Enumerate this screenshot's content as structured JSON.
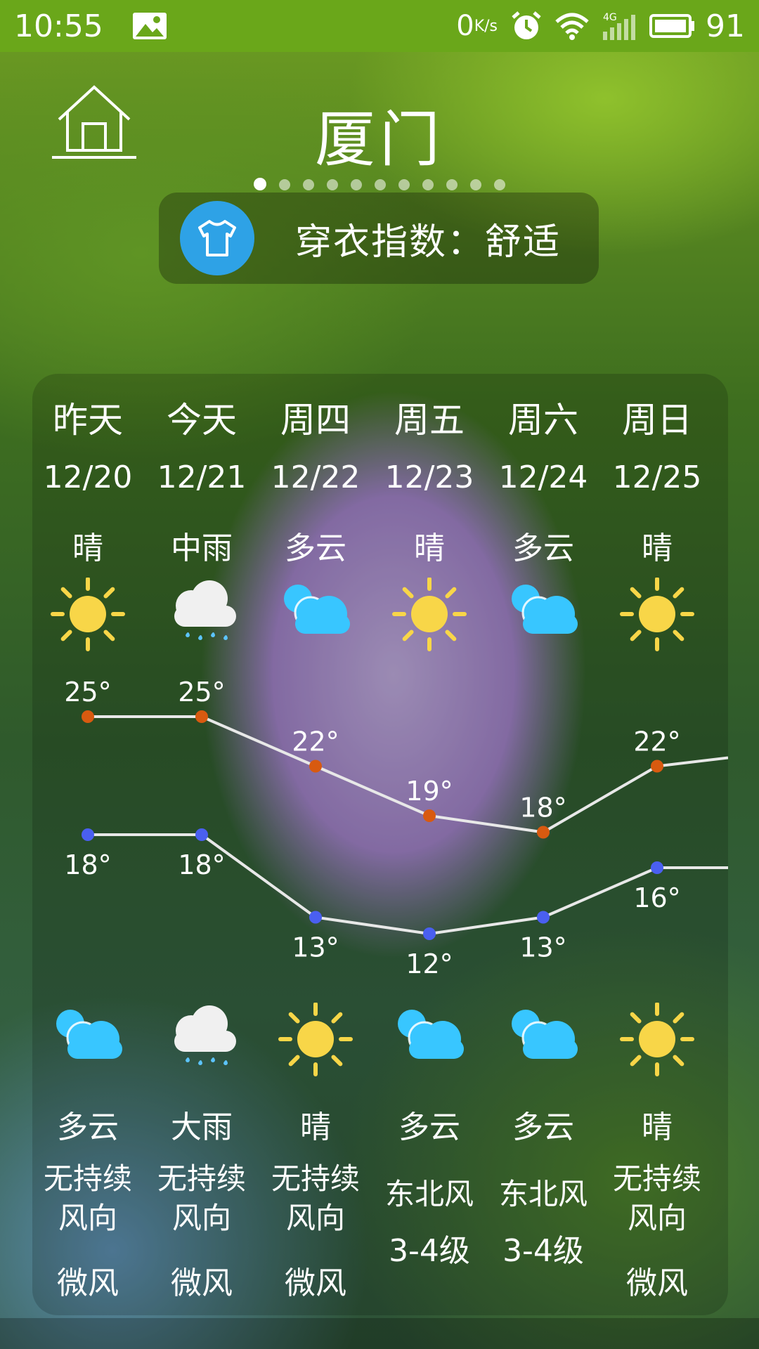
{
  "status_bar": {
    "time": "10:55",
    "net_speed": "0",
    "net_unit": "K/s",
    "network": "4G",
    "battery": "91"
  },
  "header": {
    "city": "厦门",
    "page_dots": 11,
    "active_dot": 0
  },
  "index_card": {
    "text": "穿衣指数：舒适",
    "icon": "tshirt-icon",
    "accent": "#2ea2e6"
  },
  "forecast": [
    {
      "day": "昨天",
      "date": "12/20",
      "day_cond": "晴",
      "day_icon": "sun-icon",
      "high": 25,
      "high_label": "25°",
      "low": 18,
      "low_label": "18°",
      "night_icon": "cloud-icon",
      "night_cond": "多云",
      "wind_dir": "无持续风向",
      "wind_level": "微风"
    },
    {
      "day": "今天",
      "date": "12/21",
      "day_cond": "中雨",
      "day_icon": "rain-icon",
      "high": 25,
      "high_label": "25°",
      "low": 18,
      "low_label": "18°",
      "night_icon": "rain-icon",
      "night_cond": "大雨",
      "wind_dir": "无持续风向",
      "wind_level": "微风"
    },
    {
      "day": "周四",
      "date": "12/22",
      "day_cond": "多云",
      "day_icon": "cloud-icon",
      "high": 22,
      "high_label": "22°",
      "low": 13,
      "low_label": "13°",
      "night_icon": "sun-icon",
      "night_cond": "晴",
      "wind_dir": "无持续风向",
      "wind_level": "微风"
    },
    {
      "day": "周五",
      "date": "12/23",
      "day_cond": "晴",
      "day_icon": "sun-icon",
      "high": 19,
      "high_label": "19°",
      "low": 12,
      "low_label": "12°",
      "night_icon": "cloud-icon",
      "night_cond": "多云",
      "wind_dir": "东北风",
      "wind_level": "3-4级"
    },
    {
      "day": "周六",
      "date": "12/24",
      "day_cond": "多云",
      "day_icon": "cloud-icon",
      "high": 18,
      "high_label": "18°",
      "low": 13,
      "low_label": "13°",
      "night_icon": "cloud-icon",
      "night_cond": "多云",
      "wind_dir": "东北风",
      "wind_level": "3-4级"
    },
    {
      "day": "周日",
      "date": "12/25",
      "day_cond": "晴",
      "day_icon": "sun-icon",
      "high": 22,
      "high_label": "22°",
      "low": 16,
      "low_label": "16°",
      "night_icon": "sun-icon",
      "night_cond": "晴",
      "wind_dir": "无持续风向",
      "wind_level": "微风"
    }
  ],
  "colors": {
    "status_bar": "#6aa71a",
    "high_dot": "#d85a10",
    "low_dot": "#4a5ff0",
    "line": "#e8e8e8",
    "sun": "#f8d648",
    "cloud": "#38c6ff",
    "rain_cloud": "#f0f0f0",
    "raindrop": "#5cc4ff"
  }
}
